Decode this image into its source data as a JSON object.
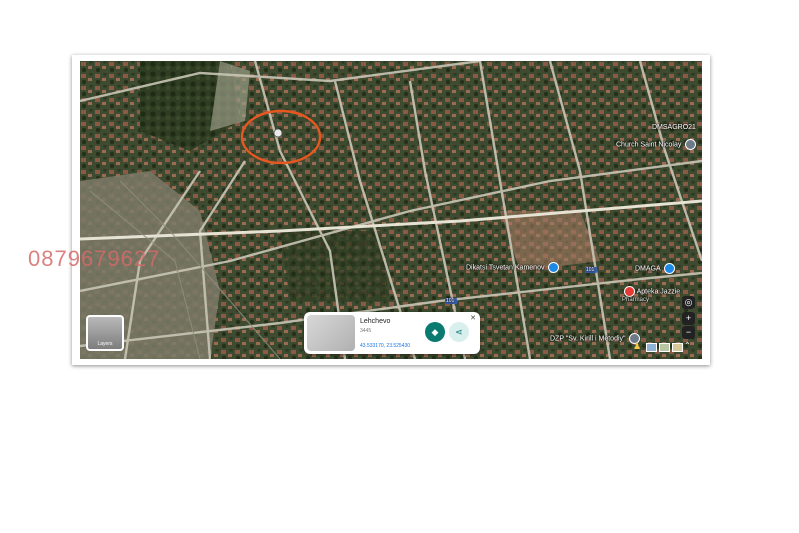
{
  "watermark": "0879679627",
  "pois": [
    {
      "label": "DMSAGRO21",
      "sub": "",
      "color": "#6c7a89"
    },
    {
      "label": "Church Saint Nicolay",
      "sub": "",
      "color": "#6c7a89"
    },
    {
      "label": "Dikatsi Tsvetan Kamenov",
      "sub": "",
      "color": "#1e88e5"
    },
    {
      "label": "DMAGA",
      "sub": "",
      "color": "#1e88e5"
    },
    {
      "label": "Apteka Jazzie",
      "sub": "Pharmacy",
      "color": "#e53935"
    },
    {
      "label": "DZP \"Sv. Kirill i Metodiy\"",
      "sub": "",
      "color": "#6c7a89"
    }
  ],
  "layers_button": {
    "label": "Layers"
  },
  "place_card": {
    "name": "Lehchevo",
    "code": "3445",
    "coords": "43.533170, 23.525430",
    "close_label": "✕"
  },
  "road_shields": [
    "101",
    "101"
  ],
  "icons": {
    "directions": "directions-icon",
    "share": "share-icon",
    "locate": "locate-icon",
    "pegman": "pegman-icon"
  },
  "colors": {
    "highlight_circle": "#e8571f",
    "watermark": "#d66a6a",
    "directions_button": "#0b7a70"
  }
}
